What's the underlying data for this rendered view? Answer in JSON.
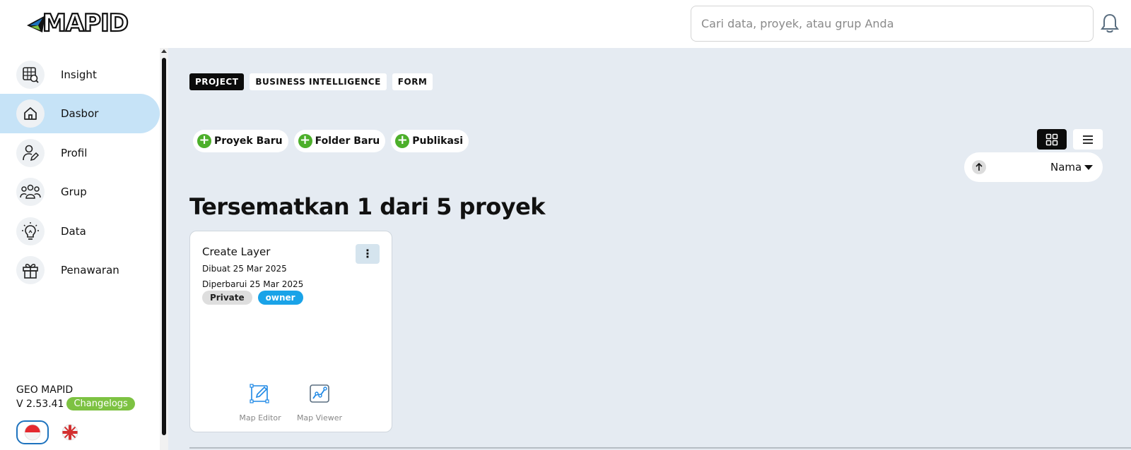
{
  "header": {
    "logo_text": "MAPID",
    "search_placeholder": "Cari data, proyek, atau grup Anda"
  },
  "sidebar": {
    "items": [
      {
        "label": "Insight",
        "icon": "insight-icon"
      },
      {
        "label": "Dasbor",
        "icon": "home-icon",
        "active": true
      },
      {
        "label": "Profil",
        "icon": "profile-edit-icon"
      },
      {
        "label": "Grup",
        "icon": "group-icon"
      },
      {
        "label": "Data",
        "icon": "lightbulb-icon"
      },
      {
        "label": "Penawaran",
        "icon": "gift-icon"
      }
    ],
    "app_name": "GEO MAPID",
    "version": "V 2.53.41",
    "changelog_label": "Changelogs",
    "languages": [
      "indonesia-flag-icon",
      "uk-flag-icon"
    ]
  },
  "main": {
    "tabs": [
      {
        "label": "PROJECT",
        "active": true
      },
      {
        "label": "BUSINESS INTELLIGENCE",
        "active": false
      },
      {
        "label": "FORM",
        "active": false
      }
    ],
    "actions": [
      {
        "label": "Proyek Baru"
      },
      {
        "label": "Folder Baru"
      },
      {
        "label": "Publikasi"
      }
    ],
    "sort": {
      "label": "Nama"
    },
    "pinned_title": "Tersematkan 1 dari 5 proyek",
    "card": {
      "title": "Create Layer",
      "created": "Dibuat 25 Mar 2025",
      "updated": "Diperbarui 25 Mar 2025",
      "badges": [
        "Private",
        "owner"
      ],
      "tools": [
        {
          "label": "Map Editor"
        },
        {
          "label": "Map Viewer"
        }
      ]
    }
  },
  "colors": {
    "accent_blue": "#1aa3e8",
    "active_nav": "#c6e3f7",
    "green": "#4caf2a",
    "main_bg": "#e5ebf2"
  }
}
